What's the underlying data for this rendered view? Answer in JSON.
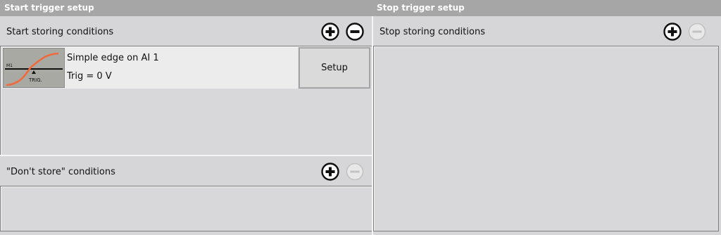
{
  "start_panel": {
    "header": "Start trigger setup",
    "storing_label": "Start storing conditions",
    "condition": {
      "title": "Simple edge on AI 1",
      "subtitle": "Trig = 0 V",
      "thumb_label": "TRIG.",
      "thumb_small": "M1",
      "setup_label": "Setup"
    },
    "dont_store_label": "\"Don't store\" conditions"
  },
  "stop_panel": {
    "header": "Stop trigger setup",
    "storing_label": "Stop storing conditions"
  },
  "colors": {
    "header_bg": "#a6a6a6",
    "panel_bg": "#d6d5d8",
    "curve": "#f06a3c"
  }
}
